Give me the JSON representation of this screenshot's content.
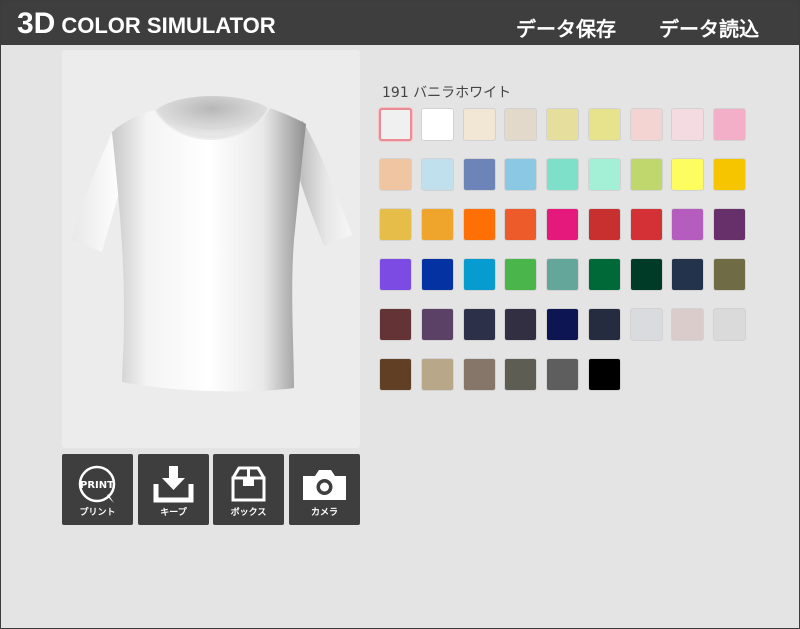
{
  "header": {
    "logo_big": "3D",
    "logo_small": "COLOR SIMULATOR",
    "save_label": "データ保存",
    "load_label": "データ読込"
  },
  "selected_color": {
    "label": "191 バニラホワイト",
    "hex": "#f1f0f1"
  },
  "tools": [
    {
      "name": "print",
      "label": "プリント",
      "icon": "print-badge-icon"
    },
    {
      "name": "keep",
      "label": "キープ",
      "icon": "download-icon"
    },
    {
      "name": "box",
      "label": "ボックス",
      "icon": "box-icon"
    },
    {
      "name": "camera",
      "label": "カメラ",
      "icon": "camera-icon"
    }
  ],
  "print_icon_text": "PRINT",
  "swatches": [
    "#f1f0f1",
    "#ffffff",
    "#f2e7d4",
    "#e2d9cb",
    "#e5de9d",
    "#e7e38c",
    "#f4d4d2",
    "#f3dbe1",
    "#f3aec8",
    "#f0c6a2",
    "#bfe0ec",
    "#6c84b8",
    "#8ac8e4",
    "#7fe0c9",
    "#a3f0d6",
    "#bfd76c",
    "#fdfd60",
    "#f6c500",
    "#e6bd48",
    "#efa52c",
    "#fe6f06",
    "#ec5b29",
    "#e5197b",
    "#c7302e",
    "#d33135",
    "#b55dbe",
    "#68306a",
    "#7c4be4",
    "#0432a2",
    "#079ccf",
    "#49b54a",
    "#64a79a",
    "#006938",
    "#003b28",
    "#22334b",
    "#6e6b45",
    "#633335",
    "#5c4167",
    "#2c3049",
    "#322f43",
    "#0d1552",
    "#252c40",
    "#dadbde",
    "#d9cccb",
    "#dadada",
    "#603f24",
    "#b8a788",
    "#86766a",
    "#5e5d54",
    "#5e5e5e",
    "#000000"
  ],
  "colors": {
    "header_bg": "#3e3e3e",
    "panel_bg": "#e4e4e4",
    "selected_border": "#e98c95"
  }
}
